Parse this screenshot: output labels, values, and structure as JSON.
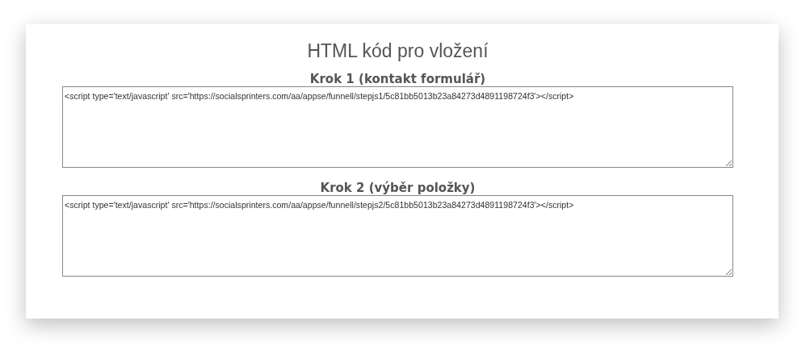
{
  "title": "HTML kód pro vložení",
  "steps": [
    {
      "label": "Krok 1 (kontakt formulář)",
      "code": "<script type='text/javascript' src='https://socialsprinters.com/aa/appse/funnell/stepjs1/5c81bb5013b23a84273d4891198724f3'></script>"
    },
    {
      "label": "Krok 2 (výběr položky)",
      "code": "<script type='text/javascript' src='https://socialsprinters.com/aa/appse/funnell/stepjs2/5c81bb5013b23a84273d4891198724f3'></script>"
    }
  ]
}
